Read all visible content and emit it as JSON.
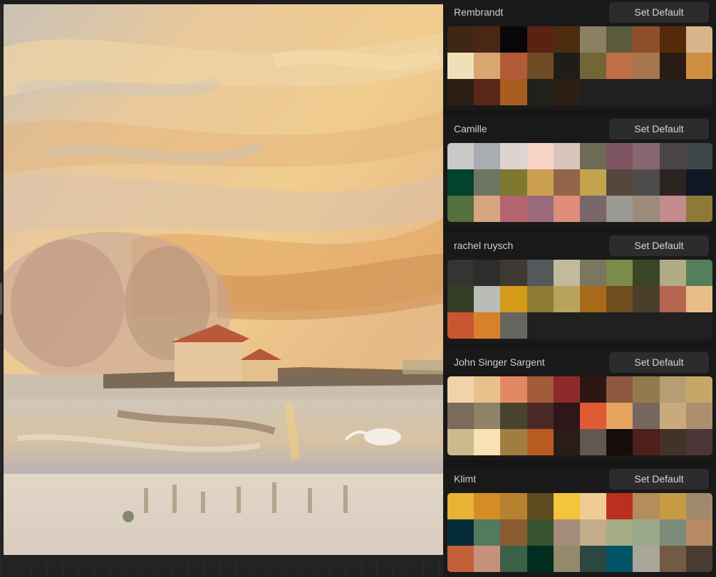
{
  "palettes": [
    {
      "name": "Rembrandt",
      "button": "Set Default",
      "colors": [
        "#3e2715",
        "#4a2614",
        "#070707",
        "#5a2213",
        "#4d2c10",
        "#8c8063",
        "#5a5a3c",
        "#8e4e2c",
        "#552a0b",
        "#d7b58a",
        "#efe0b8",
        "#d8a66e",
        "#b35a38",
        "#6e4b25",
        "#1f1d19",
        "#726637",
        "#c26e47",
        "#a6744d",
        "#2a1c14",
        "#cf8f42",
        "#2b1f15",
        "#5a2617",
        "#a85e21",
        "#1f221a",
        "#2c1f15"
      ]
    },
    {
      "name": "Camille",
      "button": "Set Default",
      "colors": [
        "#c9c9c7",
        "#a8adb1",
        "#ddd3d0",
        "#f6d3c5",
        "#d9c4bd",
        "#6d6b55",
        "#7d5662",
        "#876871",
        "#4a4549",
        "#40474b",
        "#02432c",
        "#6f7563",
        "#7f7930",
        "#ca9f51",
        "#926548",
        "#c2a34e",
        "#55463e",
        "#4e4c4b",
        "#2b2421",
        "#111623",
        "#53703e",
        "#d8a581",
        "#b5636e",
        "#9a6a78",
        "#dd8d79",
        "#786668",
        "#9b9a93",
        "#9c8b7a",
        "#c38a8f",
        "#8e7a37"
      ]
    },
    {
      "name": "rachel ruysch",
      "button": "Set Default",
      "colors": [
        "#343433",
        "#2d2d2c",
        "#3e3a32",
        "#545a5b",
        "#c3b99c",
        "#7a7660",
        "#7a8c4a",
        "#3a4525",
        "#afac86",
        "#557e5a",
        "#343c24",
        "#b9bcb6",
        "#d49a1a",
        "#8e7c35",
        "#b8a35d",
        "#a96a1a",
        "#704d1f",
        "#4a3f2b",
        "#b46650",
        "#e8be87",
        "#c95630",
        "#d8812a",
        "#676560"
      ]
    },
    {
      "name": "John Singer Sargent",
      "button": "Set Default",
      "colors": [
        "#f2d2a9",
        "#e8c08b",
        "#e38962",
        "#a25a37",
        "#8c2a2b",
        "#2e1613",
        "#8d5742",
        "#927a4c",
        "#b69d74",
        "#c7a66a",
        "#7a6b5d",
        "#8e8366",
        "#48432f",
        "#4a2a26",
        "#2f161a",
        "#e05a34",
        "#e6a35e",
        "#756760",
        "#c9aa7c",
        "#ad8f6d",
        "#cdb98c",
        "#f7e1b5",
        "#a07d40",
        "#b95c21",
        "#2a1c16",
        "#625851",
        "#140d0a",
        "#4f1f1c",
        "#433326",
        "#4b3637"
      ]
    },
    {
      "name": "Klimt",
      "button": "Set Default",
      "colors": [
        "#e7b335",
        "#d58c24",
        "#b7822f",
        "#5e4b20",
        "#f4c43a",
        "#f1cc92",
        "#bb2f20",
        "#b58c5c",
        "#c59a42",
        "#a18a6b",
        "#062c37",
        "#527a5f",
        "#8a5c31",
        "#38532f",
        "#a48b7c",
        "#c4ad8a",
        "#a6ad85",
        "#9ba88c",
        "#7b8c7d",
        "#b78b63",
        "#c2603a",
        "#c6917b",
        "#3c6146",
        "#002e21",
        "#938a6e",
        "#2c4641",
        "#005466",
        "#a8a699",
        "#735a43",
        "#4a3b31"
      ]
    }
  ]
}
